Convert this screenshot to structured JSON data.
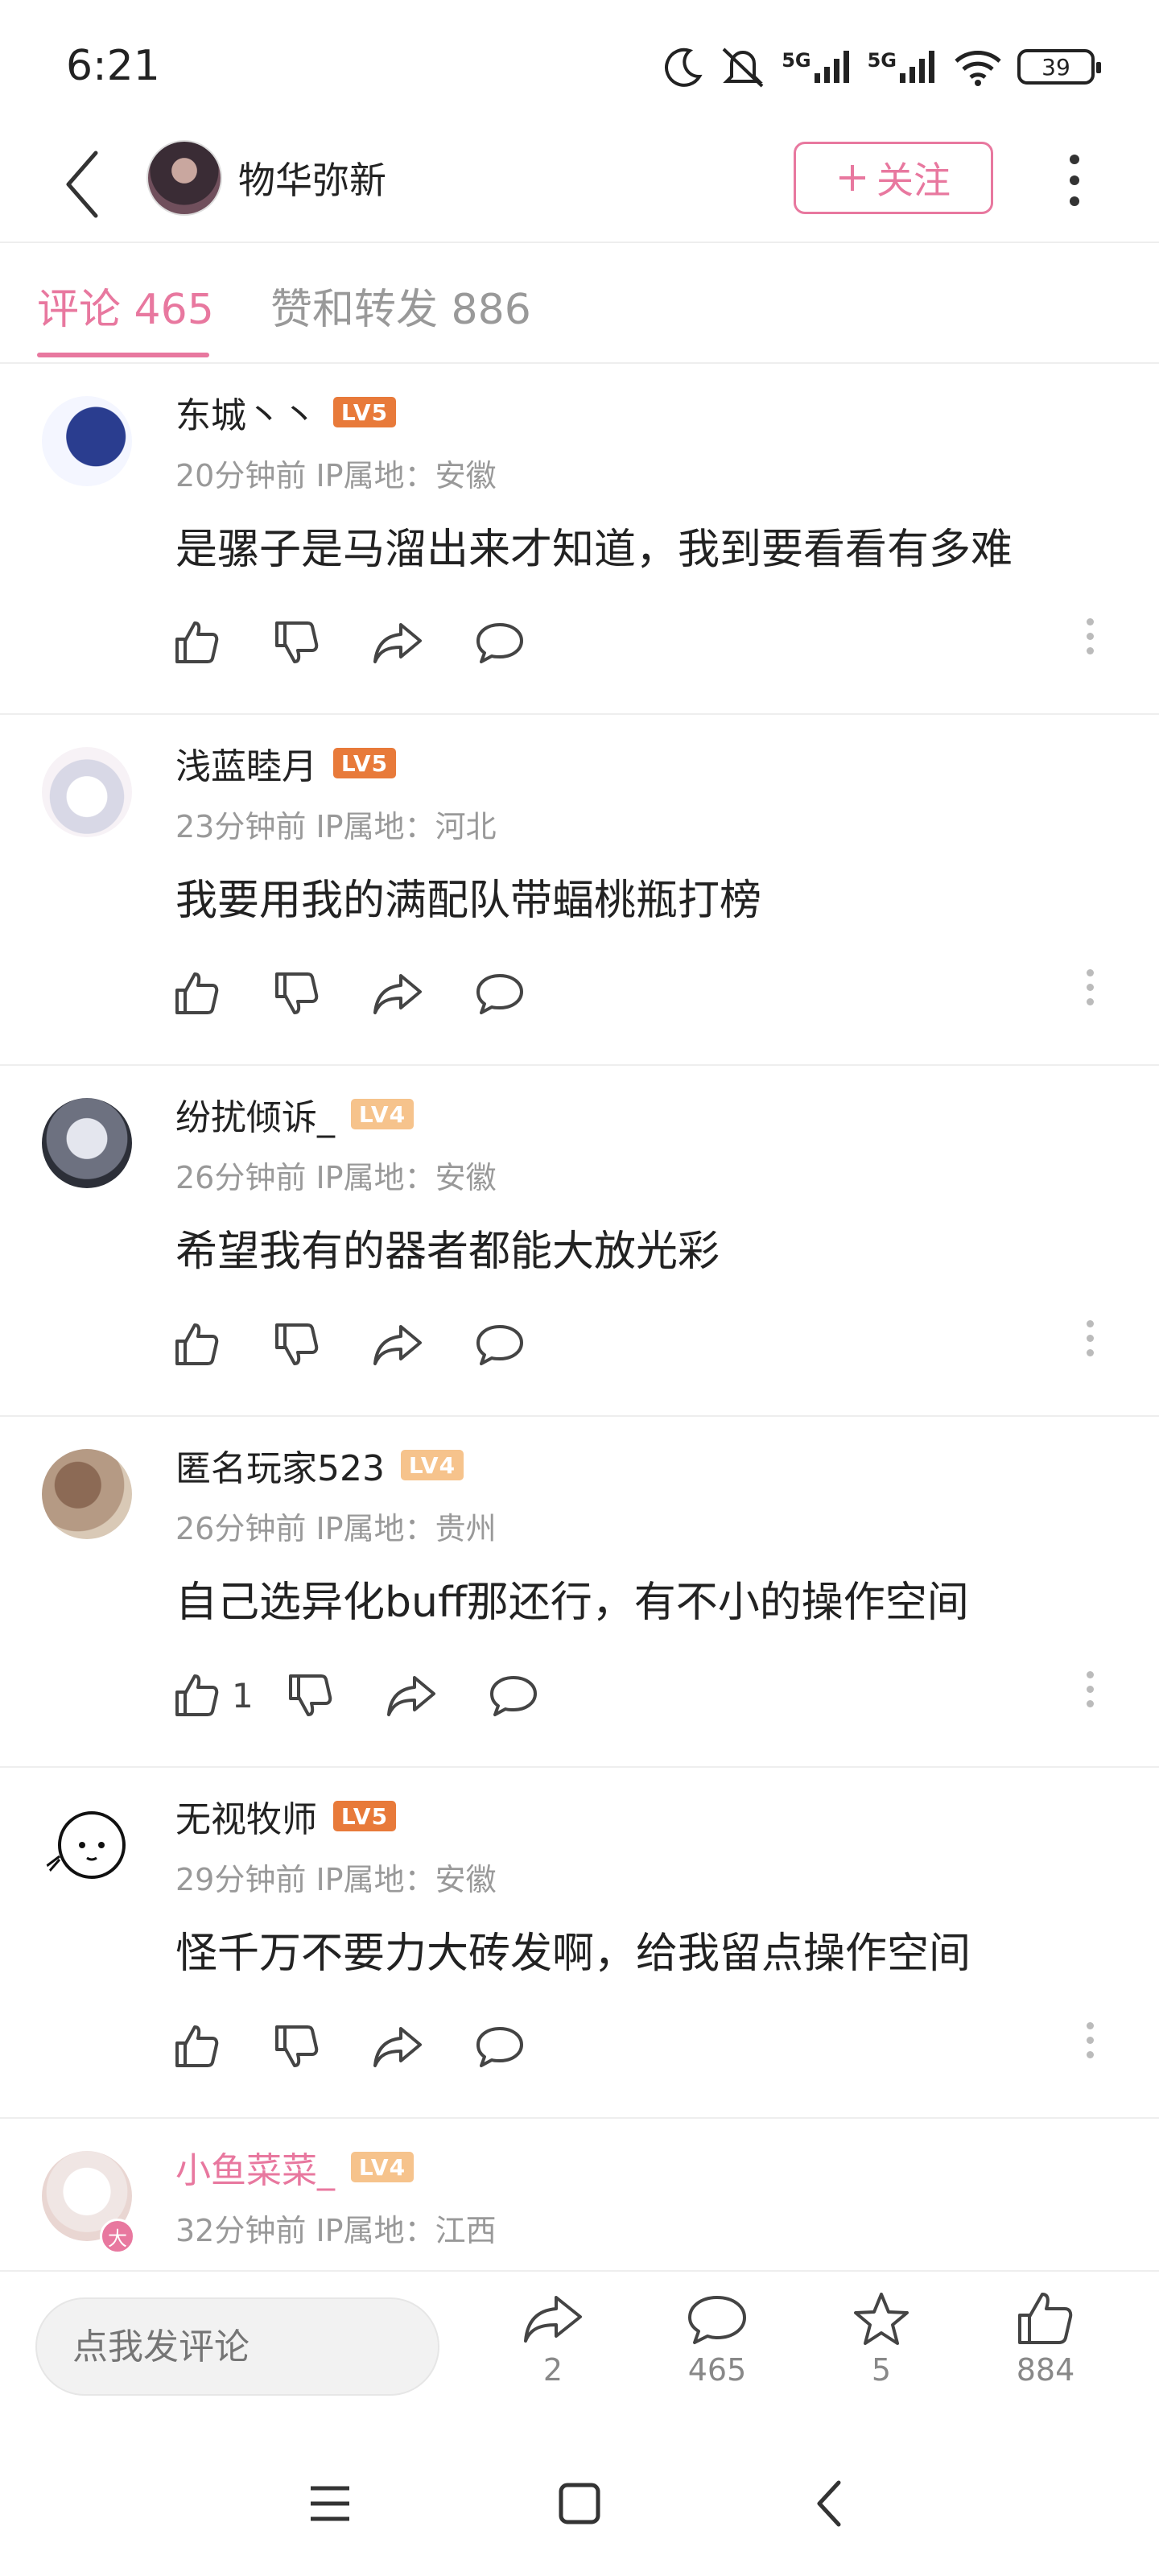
{
  "status_bar": {
    "time": "6:21",
    "network_labels": [
      "5G",
      "5G"
    ],
    "battery": "39"
  },
  "header": {
    "username": "物华弥新",
    "follow_label": "关注"
  },
  "tabs": [
    {
      "label": "评论 465",
      "active": true
    },
    {
      "label": "赞和转发 886",
      "active": false
    }
  ],
  "comments": [
    {
      "name": "东城丶丶",
      "level": "LV5",
      "time": "20分钟前",
      "ip": "IP属地：安徽",
      "text": "是骡子是马溜出来才知道，我到要看看有多难",
      "likes": ""
    },
    {
      "name": "浅蓝睦月",
      "level": "LV5",
      "time": "23分钟前",
      "ip": "IP属地：河北",
      "text": "我要用我的满配队带蝠桃瓶打榜",
      "likes": ""
    },
    {
      "name": "纷扰倾诉_",
      "level": "LV4",
      "time": "26分钟前",
      "ip": "IP属地：安徽",
      "text": "希望我有的器者都能大放光彩",
      "likes": ""
    },
    {
      "name": "匿名玩家523",
      "level": "LV4",
      "time": "26分钟前",
      "ip": "IP属地：贵州",
      "text": "自己选异化buff那还行，有不小的操作空间",
      "likes": "1"
    },
    {
      "name": "无视牧师",
      "level": "LV5",
      "time": "29分钟前",
      "ip": "IP属地：安徽",
      "text": "怪千万不要力大砖发啊，给我留点操作空间",
      "likes": ""
    },
    {
      "name": "小鱼菜菜_",
      "level": "LV4",
      "time": "32分钟前",
      "ip": "IP属地：江西",
      "text": "",
      "likes": "",
      "badge": "大"
    }
  ],
  "bottom_bar": {
    "input_placeholder": "点我发评论",
    "share_count": "2",
    "comment_count": "465",
    "favorite_count": "5",
    "like_count": "884"
  },
  "colors": {
    "accent": "#e8789f",
    "lv5": "#e87a3a",
    "lv4": "#f6c38c",
    "muted": "#999999"
  },
  "icons": [
    "back-icon",
    "more-icon",
    "plus-icon",
    "like-icon",
    "dislike-icon",
    "share-icon",
    "comment-icon",
    "star-icon",
    "menu-icon",
    "home-icon",
    "nav-back-icon"
  ]
}
